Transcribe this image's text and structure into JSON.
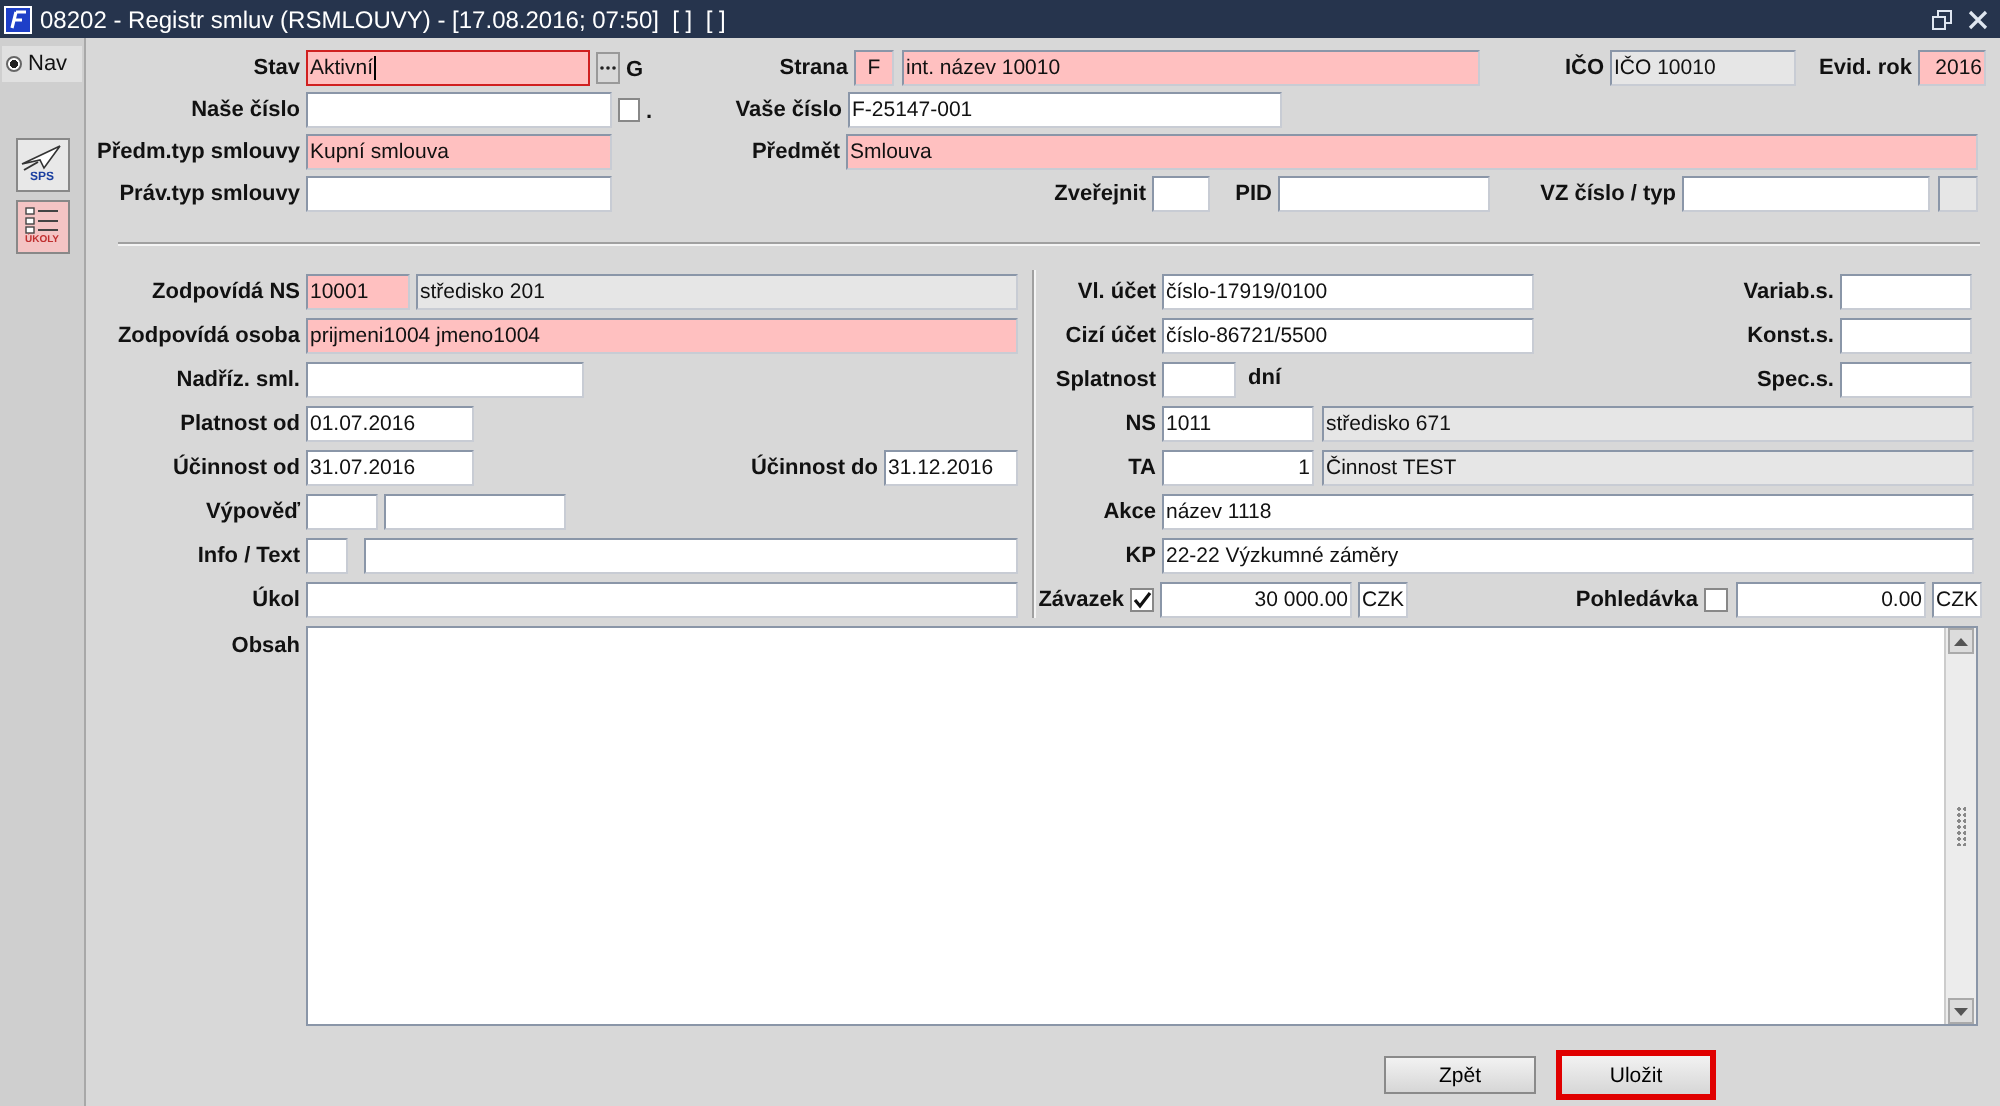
{
  "window": {
    "title": "08202 - Registr smluv (RSMLOUVY) - [17.08.2016; 07:50]  [ ]  [ ]"
  },
  "sidebar": {
    "nav": {
      "label": "Nav",
      "selected": true
    },
    "tools": [
      {
        "label": "SPS",
        "kind": "plane"
      },
      {
        "label": "ÚKOLY",
        "kind": "list"
      }
    ]
  },
  "header_rows": [
    [
      {
        "kind": "field",
        "label": "Stav",
        "value": "Aktivní",
        "required": true,
        "focused": true
      },
      {
        "kind": "lookup"
      },
      {
        "kind": "text",
        "value": "G"
      },
      {
        "kind": "field",
        "label": "Strana",
        "value": "F",
        "required": true,
        "centered": true
      },
      {
        "kind": "field",
        "value": "int. název 10010",
        "required": true
      },
      {
        "kind": "field",
        "label": "IČO",
        "value": "IČO 10010",
        "readonly": true
      },
      {
        "kind": "field",
        "label": "Evid. rok",
        "value": "2016",
        "required": true,
        "right_aligned": true
      }
    ],
    [
      {
        "kind": "field",
        "label": "Naše číslo"
      },
      {
        "kind": "checkbox",
        "checked": false
      },
      {
        "kind": "text",
        "value": "."
      },
      {
        "kind": "field",
        "label": "Vaše číslo",
        "value": "F-25147-001"
      }
    ],
    [
      {
        "kind": "field",
        "label": "Předm.typ smlouvy",
        "value": "Kupní smlouva",
        "required": true
      },
      {
        "kind": "field",
        "label": "Předmět",
        "value": "Smlouva",
        "required": true
      }
    ],
    [
      {
        "kind": "field",
        "label": "Práv.typ smlouvy"
      },
      {
        "kind": "field",
        "label": "Zveřejnit"
      },
      {
        "kind": "field",
        "label": "PID"
      },
      {
        "kind": "field",
        "label": "VZ číslo / typ"
      },
      {
        "kind": "field",
        "readonly": true
      }
    ]
  ],
  "left_rows": [
    [
      {
        "kind": "field",
        "label": "Zodpovídá NS",
        "value": "10001",
        "required": true
      },
      {
        "kind": "field",
        "value": "středisko 201",
        "readonly": true
      }
    ],
    [
      {
        "kind": "field",
        "label": "Zodpovídá osoba",
        "value": "prijmeni1004 jmeno1004",
        "required": true
      }
    ],
    [
      {
        "kind": "field",
        "label": "Nadříz. sml."
      }
    ],
    [
      {
        "kind": "field",
        "label": "Platnost od",
        "value": "01.07.2016"
      }
    ],
    [
      {
        "kind": "field",
        "label": "Účinnost od",
        "value": "31.07.2016"
      },
      {
        "kind": "field",
        "label": "Účinnost do",
        "value": "31.12.2016"
      }
    ],
    [
      {
        "kind": "field",
        "label": "Výpověď"
      },
      {
        "kind": "field"
      }
    ],
    [
      {
        "kind": "field",
        "label": "Info / Text"
      },
      {
        "kind": "field"
      }
    ],
    [
      {
        "kind": "field",
        "label": "Úkol"
      }
    ]
  ],
  "right_rows": [
    [
      {
        "kind": "field",
        "label": "Vl. účet",
        "value": "číslo-17919/0100"
      },
      {
        "kind": "field",
        "label": "Variab.s."
      }
    ],
    [
      {
        "kind": "field",
        "label": "Cizí účet",
        "value": "číslo-86721/5500"
      },
      {
        "kind": "field",
        "label": "Konst.s."
      }
    ],
    [
      {
        "kind": "field",
        "label": "Splatnost"
      },
      {
        "kind": "text",
        "value": "dní"
      },
      {
        "kind": "field",
        "label": "Spec.s."
      }
    ],
    [
      {
        "kind": "field",
        "label": "NS",
        "value": "1011"
      },
      {
        "kind": "field",
        "value": "středisko 671",
        "readonly": true
      }
    ],
    [
      {
        "kind": "field",
        "label": "TA",
        "value": "1",
        "right_aligned": true
      },
      {
        "kind": "field",
        "value": "Činnost TEST",
        "readonly": true
      }
    ],
    [
      {
        "kind": "field",
        "label": "Akce",
        "value": "název 1118"
      }
    ],
    [
      {
        "kind": "field",
        "label": "KP",
        "value": "22-22 Výzkumné záměry"
      }
    ],
    [
      {
        "kind": "checkbox",
        "label": "Závazek",
        "checked": true
      },
      {
        "kind": "field",
        "value": "30 000.00",
        "right_aligned": true
      },
      {
        "kind": "field",
        "value": "CZK"
      },
      {
        "kind": "checkbox",
        "label": "Pohledávka",
        "checked": false
      },
      {
        "kind": "field",
        "value": "0.00",
        "right_aligned": true
      },
      {
        "kind": "field",
        "value": "CZK"
      }
    ]
  ],
  "content": {
    "label": "Obsah"
  },
  "buttons": [
    {
      "label": "Zpět",
      "highlighted": false
    },
    {
      "label": "Uložit",
      "highlighted": true
    }
  ]
}
